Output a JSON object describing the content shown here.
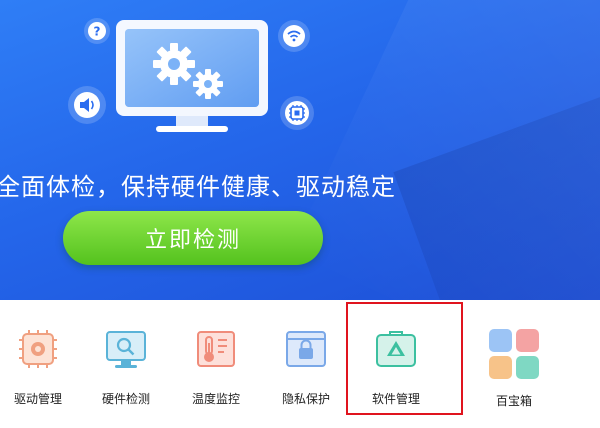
{
  "hero": {
    "headline": "全面体检，保持硬件健康、驱动稳定",
    "scan_button": "立即检测",
    "icons": [
      "monitor-gears-icon",
      "help-icon",
      "wifi-icon",
      "speaker-icon",
      "chip-icon"
    ]
  },
  "colors": {
    "hero_blue": "#2466ea",
    "button_green": "#54c21e",
    "highlight_red": "#e0141e"
  },
  "tools": [
    {
      "label": "驱动管理",
      "icon": "chip-gear-icon",
      "color": "#f0a080"
    },
    {
      "label": "硬件检测",
      "icon": "monitor-search-icon",
      "color": "#5ab3d8"
    },
    {
      "label": "温度监控",
      "icon": "thermometer-icon",
      "color": "#f08c7a"
    },
    {
      "label": "隐私保护",
      "icon": "lock-window-icon",
      "color": "#7aa8e8"
    },
    {
      "label": "软件管理",
      "icon": "software-bag-icon",
      "color": "#3cc0a0"
    },
    {
      "label": "百宝箱",
      "icon": "toolbox-grid-icon",
      "color": "#e08080"
    }
  ]
}
